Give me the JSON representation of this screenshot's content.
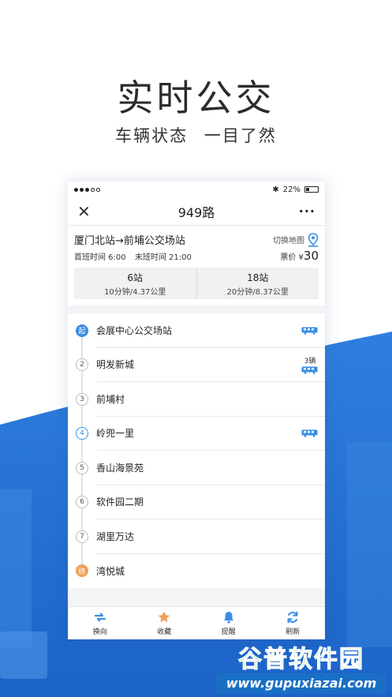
{
  "promo": {
    "title": "实时公交",
    "subtitle_left": "车辆状态",
    "subtitle_right": "一目了然"
  },
  "statusbar": {
    "battery": "22%"
  },
  "navbar": {
    "title": "949路",
    "more": "···"
  },
  "route": {
    "name": "厦门北站→前埔公交场站",
    "map_switch": "切换地图",
    "first_bus": "首班时间 6:00",
    "last_bus": "末班时间 21:00",
    "fare_label": "票价 ¥",
    "fare_value": "30"
  },
  "distances": [
    {
      "stops": "6站",
      "detail": "10分钟/4.37公里"
    },
    {
      "stops": "18站",
      "detail": "20分钟/8.37公里"
    }
  ],
  "stops": [
    {
      "badge": "起",
      "name": "会展中心公交场站"
    },
    {
      "badge": "2",
      "name": "明发新城",
      "bus_count": "3辆"
    },
    {
      "badge": "3",
      "name": "前埔村"
    },
    {
      "badge": "4",
      "name": "岭兜一里"
    },
    {
      "badge": "5",
      "name": "香山海景苑"
    },
    {
      "badge": "6",
      "name": "软件园二期"
    },
    {
      "badge": "7",
      "name": "湖里万达"
    },
    {
      "badge": "终",
      "name": "湾悦城"
    }
  ],
  "tabs": [
    {
      "label": "换向",
      "icon": "swap-icon"
    },
    {
      "label": "收藏",
      "icon": "star-icon"
    },
    {
      "label": "提醒",
      "icon": "bell-icon"
    },
    {
      "label": "刷新",
      "icon": "refresh-icon"
    }
  ],
  "watermark": {
    "title": "谷普软件园",
    "url": "www.gupuxiazai.com"
  },
  "colors": {
    "accent": "#3a8ee6",
    "end_stop": "#f0a05a",
    "watermark_green": "#3ec24b",
    "watermark_blue": "#1a6fc4"
  }
}
